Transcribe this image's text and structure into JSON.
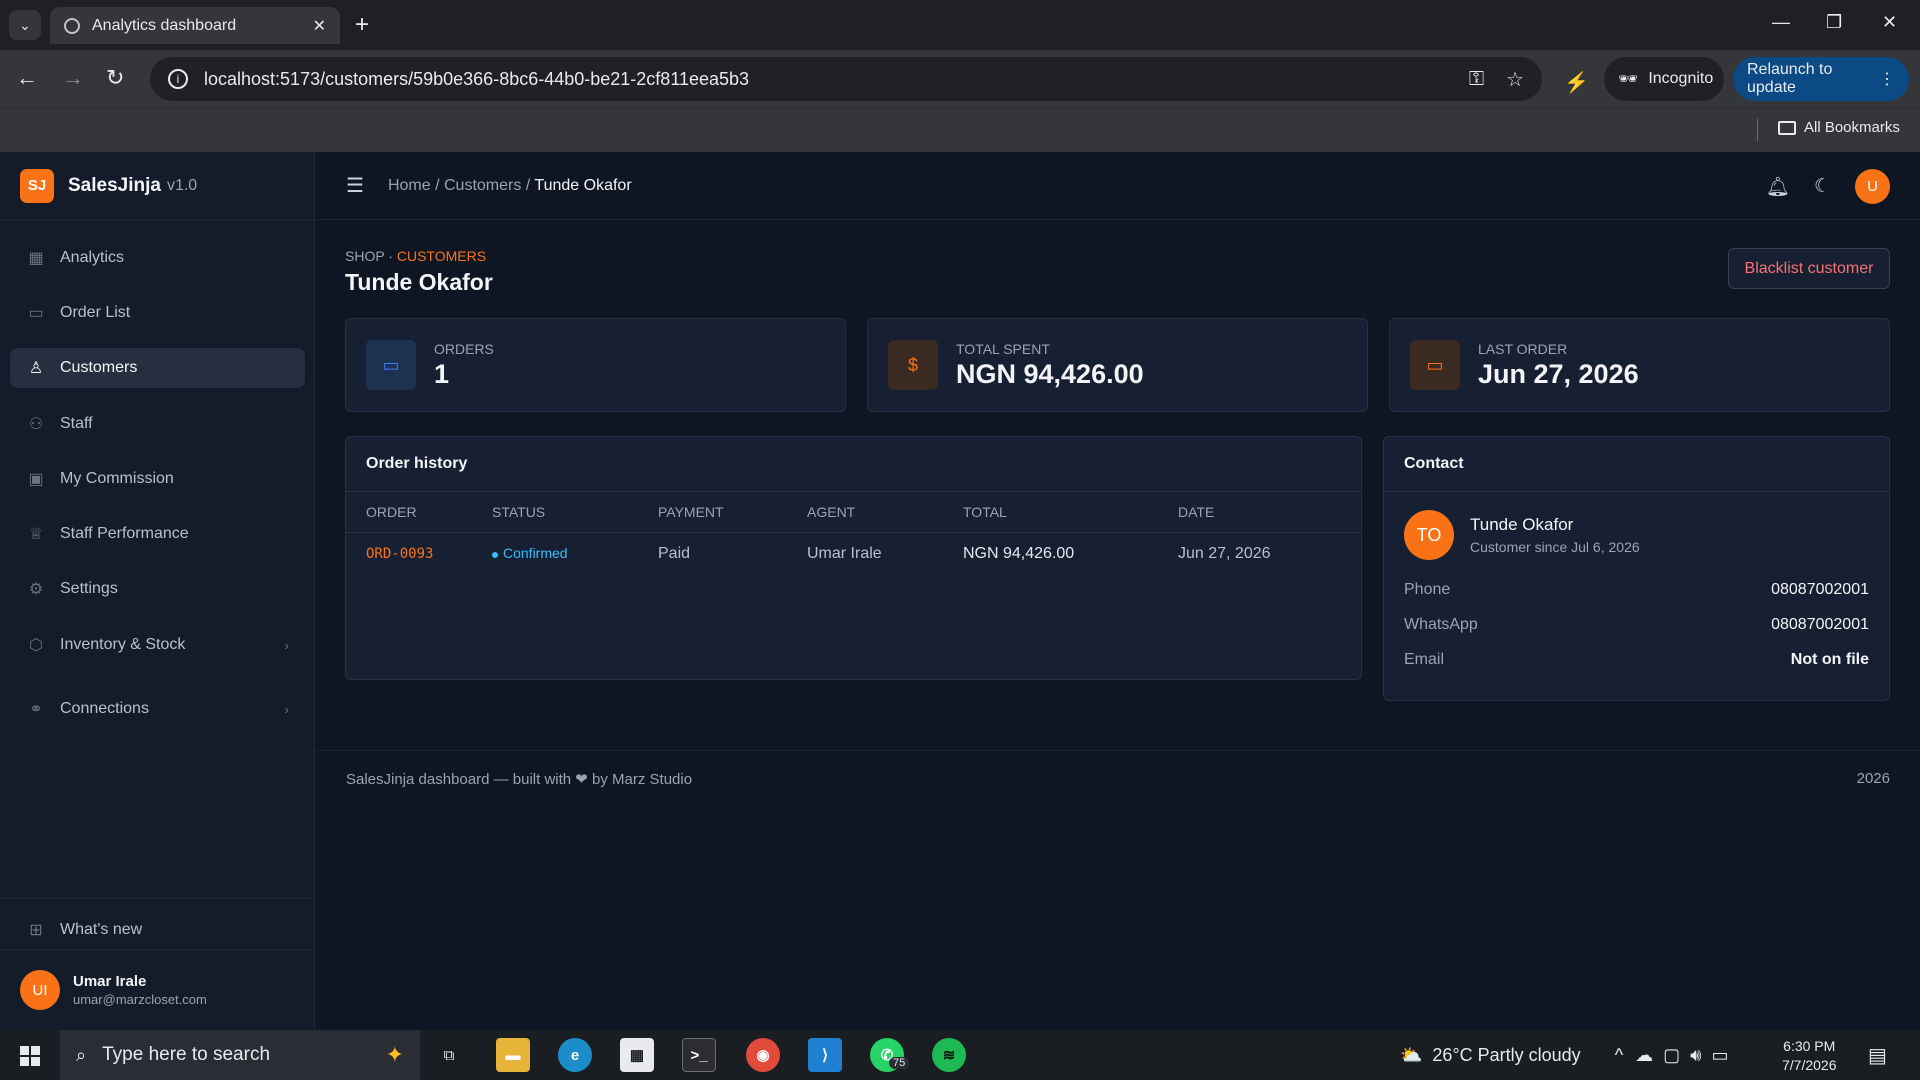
{
  "browser": {
    "tab_title": "Analytics dashboard",
    "url": "localhost:5173/customers/59b0e366-8bc6-44b0-be21-2cf811eea5b3",
    "incognito_label": "Incognito",
    "relaunch_label": "Relaunch to update",
    "bookmarks_label": "All Bookmarks"
  },
  "app": {
    "brand_initials": "SJ",
    "brand_name": "SalesJinja",
    "brand_version": "v1.0",
    "nav": [
      {
        "label": "Analytics",
        "icon": "grid-icon"
      },
      {
        "label": "Order List",
        "icon": "calendar-icon"
      },
      {
        "label": "Customers",
        "icon": "user-icon",
        "active": true
      },
      {
        "label": "Staff",
        "icon": "users-icon"
      },
      {
        "label": "My Commission",
        "icon": "money-icon"
      },
      {
        "label": "Staff Performance",
        "icon": "trophy-icon"
      },
      {
        "label": "Settings",
        "icon": "gear-icon"
      },
      {
        "label": "Inventory & Stock",
        "icon": "box-icon",
        "chevron": true
      },
      {
        "label": "Connections",
        "icon": "link-icon",
        "chevron": true
      },
      {
        "label": "What's new",
        "icon": "gift-icon"
      }
    ],
    "user": {
      "initials": "UI",
      "name": "Umar Irale",
      "email": "umar@marzcloset.com"
    },
    "topbar": {
      "crumb_home": "Home",
      "crumb_sep": "/",
      "crumb_customers": "Customers",
      "crumb_current": "Tunde Okafor",
      "avatar": "U"
    }
  },
  "page": {
    "eyebrow_shop": "SHOP · ",
    "eyebrow_section": "CUSTOMERS",
    "title": "Tunde Okafor",
    "blacklist_label": "Blacklist customer",
    "stats": [
      {
        "label": "ORDERS",
        "value": "1",
        "icon": "calendar-icon",
        "color": "#3b82f6"
      },
      {
        "label": "TOTAL SPENT",
        "value": "NGN 94,426.00",
        "icon": "dollar-icon",
        "color": "#f97316"
      },
      {
        "label": "LAST ORDER",
        "value": "Jun 27, 2026",
        "icon": "calendar-icon",
        "color": "#f97316"
      }
    ],
    "order_history": {
      "title": "Order history",
      "columns": [
        "ORDER",
        "STATUS",
        "PAYMENT",
        "AGENT",
        "TOTAL",
        "DATE"
      ],
      "rows": [
        {
          "order": "ORD-0093",
          "status": "Confirmed",
          "payment": "Paid",
          "agent": "Umar Irale",
          "total": "NGN 94,426.00",
          "date": "Jun 27, 2026"
        }
      ]
    },
    "contact": {
      "title": "Contact",
      "initials": "TO",
      "name": "Tunde Okafor",
      "since": "Customer since Jul 6, 2026",
      "fields": [
        {
          "k": "Phone",
          "v": "08087002001"
        },
        {
          "k": "WhatsApp",
          "v": "08087002001"
        },
        {
          "k": "Email",
          "v": "Not on file"
        }
      ]
    },
    "footer_left": "SalesJinja dashboard — built with ❤ by Marz Studio",
    "footer_right": "2026"
  },
  "taskbar": {
    "search_placeholder": "Type here to search",
    "weather": "26°C  Partly cloudy",
    "whatsapp_badge": "75",
    "time": "6:30 PM",
    "date": "7/7/2026"
  }
}
